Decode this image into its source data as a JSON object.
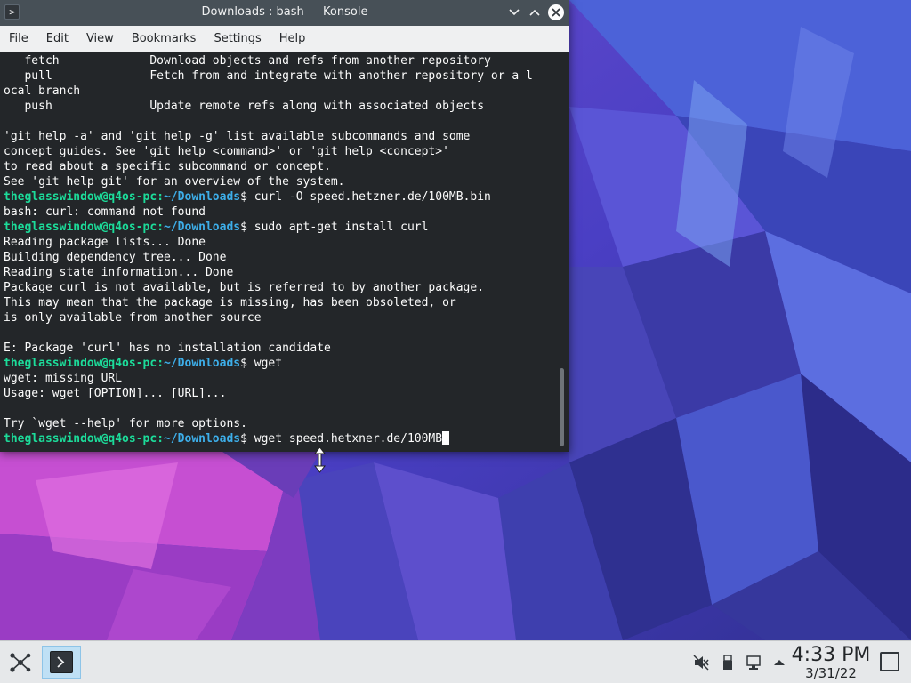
{
  "window": {
    "title": "Downloads : bash — Konsole",
    "app_icon_glyph": ">",
    "buttons": [
      "minimize",
      "maximize",
      "close"
    ]
  },
  "menubar": {
    "items": [
      "File",
      "Edit",
      "View",
      "Bookmarks",
      "Settings",
      "Help"
    ]
  },
  "terminal": {
    "lines": [
      {
        "text": "   fetch             Download objects and refs from another repository"
      },
      {
        "text": "   pull              Fetch from and integrate with another repository or a l"
      },
      {
        "text": "ocal branch"
      },
      {
        "text": "   push              Update remote refs along with associated objects"
      },
      {
        "text": ""
      },
      {
        "text": "'git help -a' and 'git help -g' list available subcommands and some"
      },
      {
        "text": "concept guides. See 'git help <command>' or 'git help <concept>'"
      },
      {
        "text": "to read about a specific subcommand or concept."
      },
      {
        "text": "See 'git help git' for an overview of the system."
      },
      {
        "user": "theglasswindow@q4os-pc",
        "path": "~/Downloads",
        "cmd": "$ curl -O speed.hetzner.de/100MB.bin"
      },
      {
        "text": "bash: curl: command not found"
      },
      {
        "user": "theglasswindow@q4os-pc",
        "path": "~/Downloads",
        "cmd": "$ sudo apt-get install curl"
      },
      {
        "text": "Reading package lists... Done"
      },
      {
        "text": "Building dependency tree... Done"
      },
      {
        "text": "Reading state information... Done"
      },
      {
        "text": "Package curl is not available, but is referred to by another package."
      },
      {
        "text": "This may mean that the package is missing, has been obsoleted, or"
      },
      {
        "text": "is only available from another source"
      },
      {
        "text": ""
      },
      {
        "text": "E: Package 'curl' has no installation candidate"
      },
      {
        "user": "theglasswindow@q4os-pc",
        "path": "~/Downloads",
        "cmd": "$ wget"
      },
      {
        "text": "wget: missing URL"
      },
      {
        "text": "Usage: wget [OPTION]... [URL]..."
      },
      {
        "text": ""
      },
      {
        "text": "Try `wget --help' for more options."
      },
      {
        "user": "theglasswindow@q4os-pc",
        "path": "~/Downloads",
        "cmd": "$ wget speed.hetxner.de/100MB",
        "cursor": true
      }
    ]
  },
  "taskbar": {
    "launcher_icon": "application-launcher-icon",
    "tasks": [
      {
        "name": "Konsole",
        "icon": "konsole-icon",
        "active": true
      }
    ],
    "tray_icons": [
      "muted-volume-icon",
      "usb-device-icon",
      "network-wired-icon",
      "expand-tray-icon"
    ],
    "clock": {
      "time": "4:33 PM",
      "date": "3/31/22"
    }
  },
  "colors": {
    "terminal_bg": "#232629",
    "terminal_fg": "#fcfcfc",
    "prompt_user": "#1cdc9a",
    "prompt_path": "#3daee9",
    "titlebar_bg": "#475057",
    "menubar_bg": "#eff0f1",
    "taskbar_bg": "#e6e8ea"
  }
}
